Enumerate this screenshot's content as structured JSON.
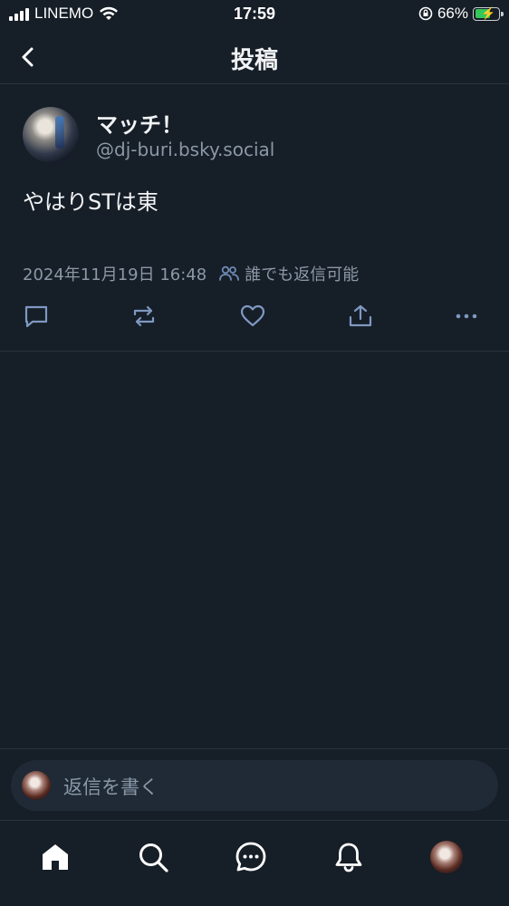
{
  "status_bar": {
    "carrier": "LINEMO",
    "time": "17:59",
    "battery_percent": "66%",
    "battery_level": 0.66,
    "icons": [
      "signal-icon",
      "wifi-icon",
      "orientation-lock-icon",
      "battery-icon"
    ]
  },
  "header": {
    "title": "投稿",
    "back_icon": "chevron-left-icon"
  },
  "post": {
    "display_name": "マッチ！",
    "handle": "@dj-buri.bsky.social",
    "text": "やはりSTは東",
    "timestamp": "2024年11月19日 16:48",
    "reply_permission": "誰でも返信可能",
    "actions": [
      "reply-icon",
      "repost-icon",
      "like-icon",
      "share-icon",
      "more-icon"
    ]
  },
  "reply_bar": {
    "placeholder": "返信を書く"
  },
  "tab_bar": {
    "items": [
      "home-icon",
      "search-icon",
      "chat-icon",
      "notifications-icon",
      "profile-avatar"
    ]
  },
  "colors": {
    "background": "#161e27",
    "text": "#f1f3f5",
    "secondary_text": "#8b98a7",
    "divider": "#2a3340",
    "battery_fill": "#34c759"
  }
}
